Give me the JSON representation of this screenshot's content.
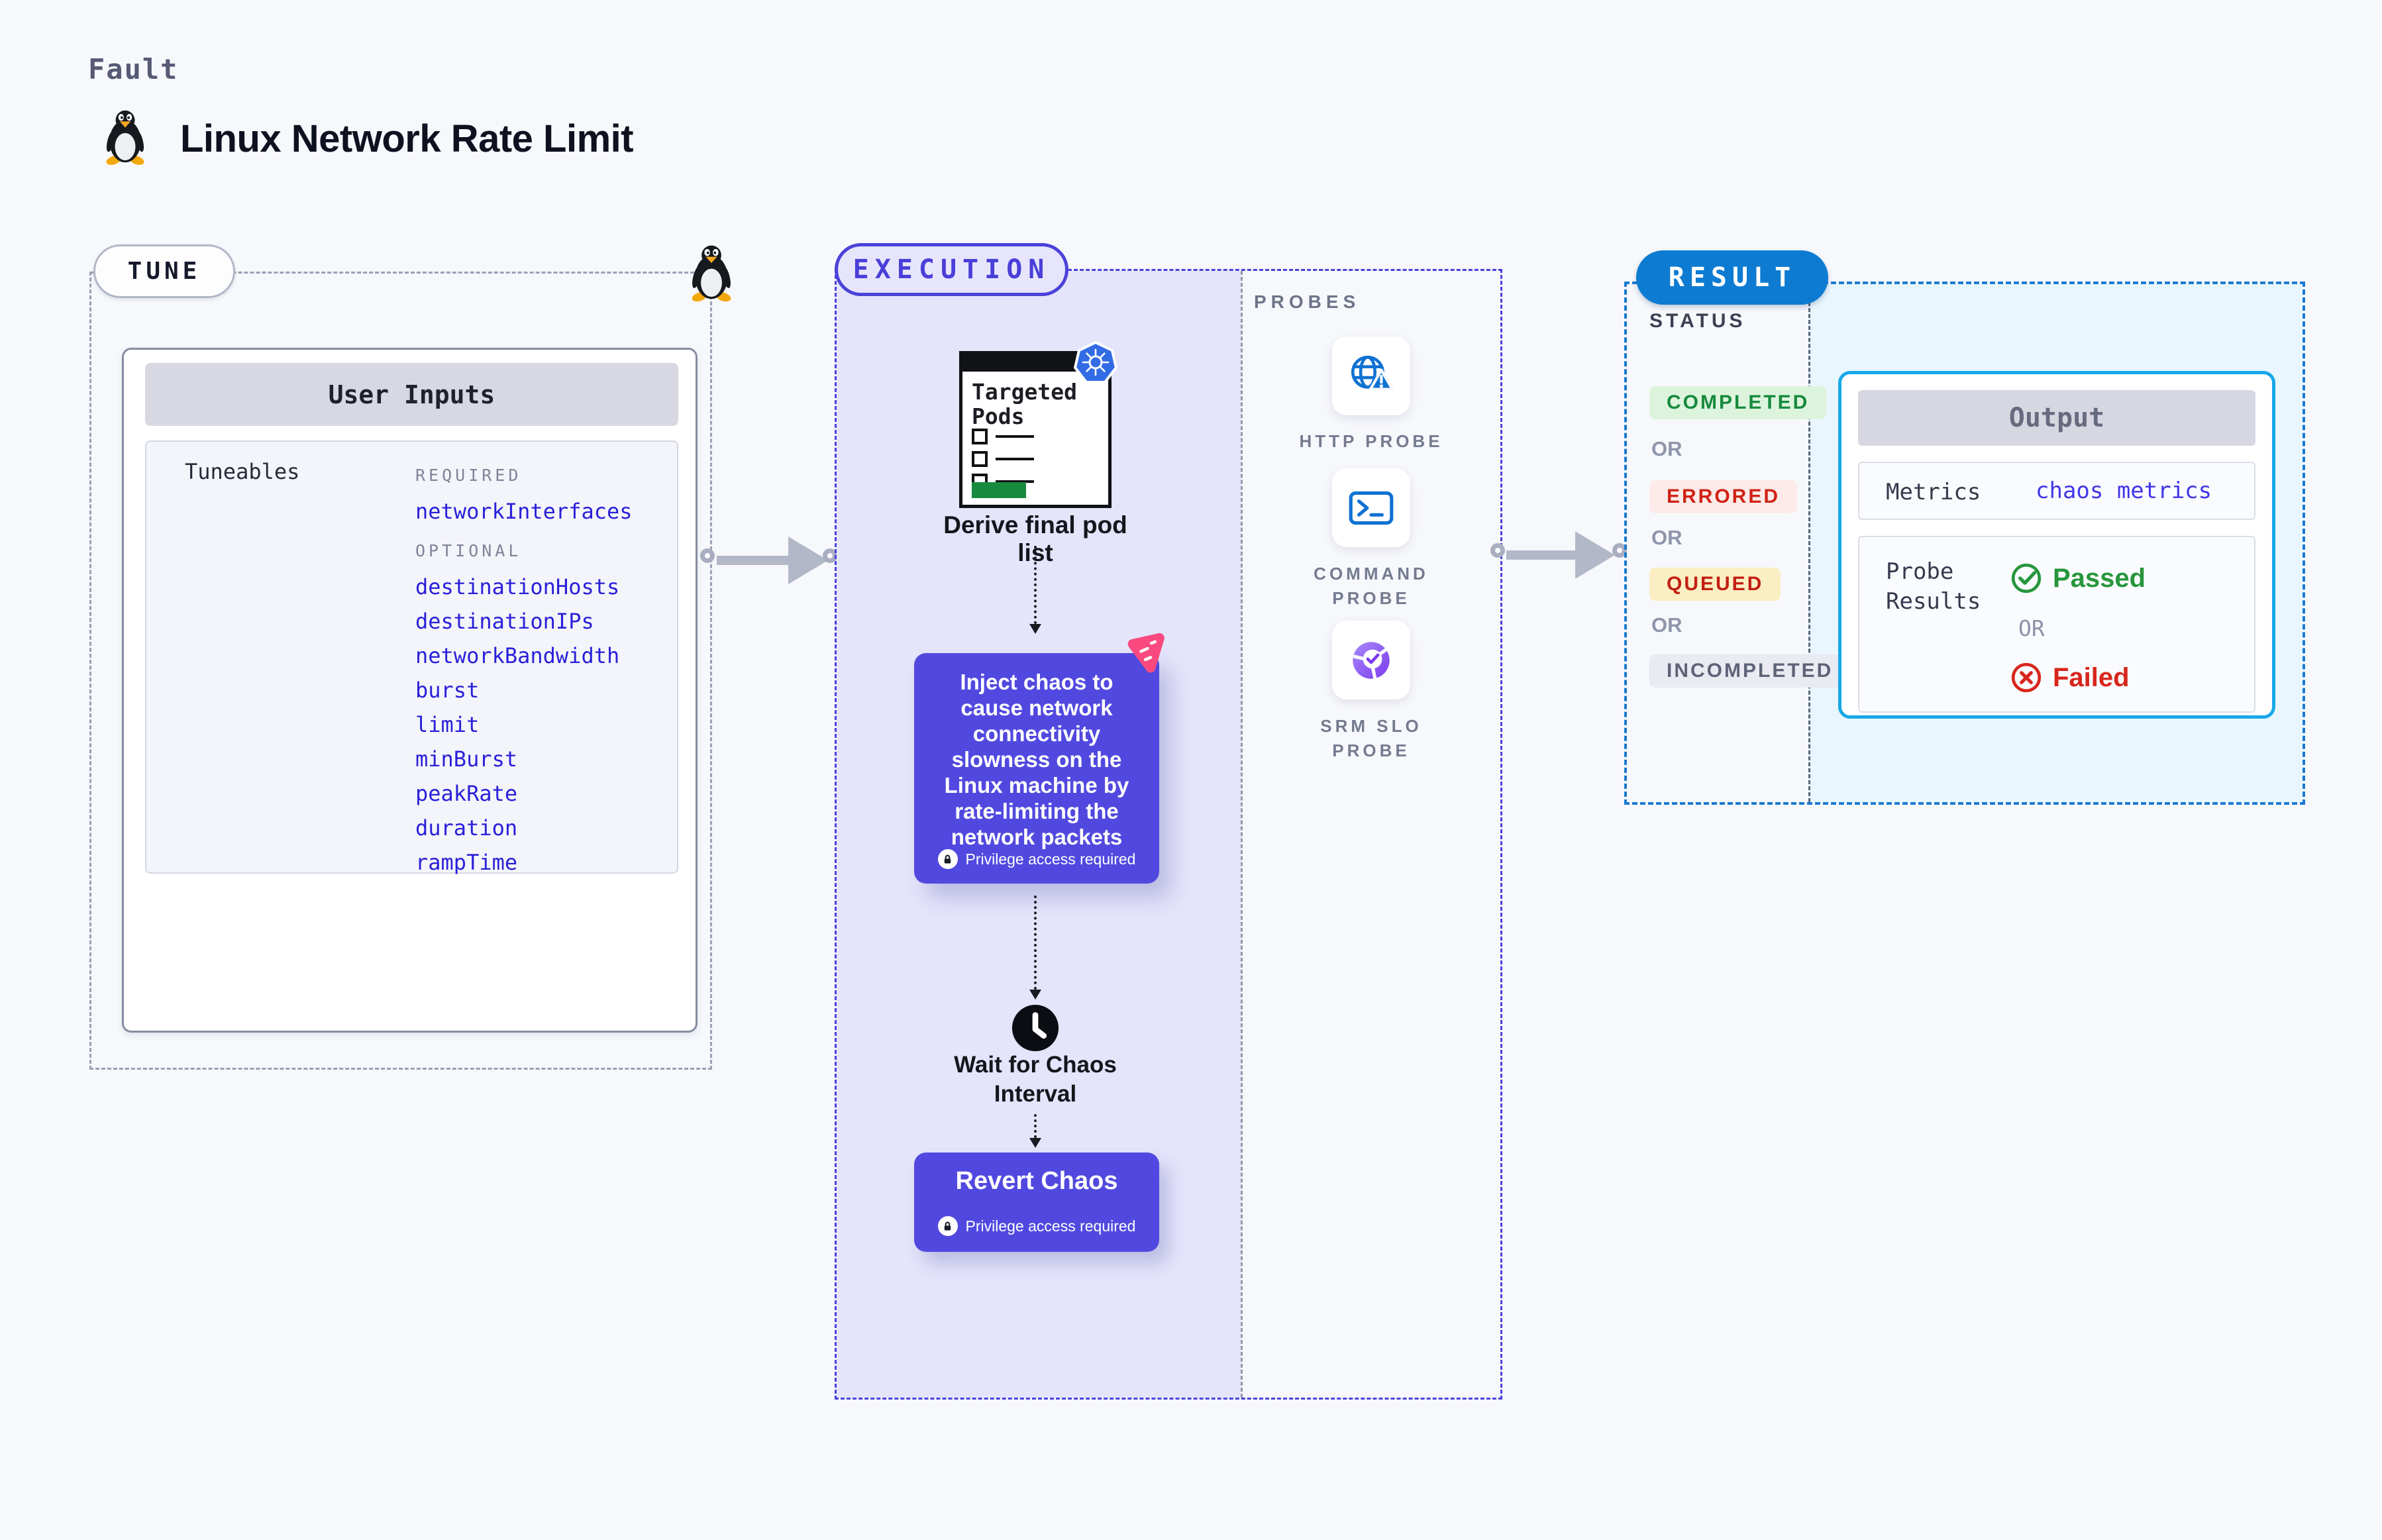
{
  "page": {
    "kicker": "Fault",
    "title": "Linux Network Rate Limit"
  },
  "tune": {
    "badge": "TUNE",
    "user_inputs_title": "User Inputs",
    "tuneables_label": "Tuneables",
    "required_label": "REQUIRED",
    "required_items": [
      "networkInterfaces"
    ],
    "optional_label": "OPTIONAL",
    "optional_items": [
      "destinationHosts",
      "destinationIPs",
      "networkBandwidth",
      "burst",
      "limit",
      "minBurst",
      "peakRate",
      "duration",
      "rampTime"
    ]
  },
  "execution": {
    "badge": "EXECUTION",
    "targeted_pods_label": "Targeted Pods",
    "derive_label": "Derive final pod list",
    "inject_text": "Inject chaos to cause network connectivity slowness on the Linux machine by rate-limiting the network packets",
    "privilege_label": "Privilege access required",
    "wait_label": "Wait for Chaos Interval",
    "revert_label": "Revert Chaos"
  },
  "probes": {
    "section_label": "PROBES",
    "items": [
      {
        "label": "HTTP PROBE",
        "icon": "http-probe-icon"
      },
      {
        "label": "COMMAND\nPROBE",
        "icon": "command-probe-icon"
      },
      {
        "label": "SRM SLO\nPROBE",
        "icon": "srm-slo-probe-icon"
      }
    ]
  },
  "result": {
    "badge": "RESULT",
    "status_label": "STATUS",
    "or_label": "OR",
    "statuses": [
      {
        "label": "COMPLETED",
        "color": "#168a3d",
        "bg": "#ddf4dc"
      },
      {
        "label": "ERRORED",
        "color": "#cf2318",
        "bg": "#fcebe8"
      },
      {
        "label": "QUEUED",
        "color": "#c21f14",
        "bg": "#fbeec2"
      },
      {
        "label": "INCOMPLETED",
        "color": "#5e6377",
        "bg": "#e9eaf2"
      }
    ],
    "output": {
      "title": "Output",
      "metrics_label": "Metrics",
      "metrics_value": "chaos metrics",
      "probe_results_label": "Probe Results",
      "passed_label": "Passed",
      "or_label": "OR",
      "failed_label": "Failed"
    }
  },
  "colors": {
    "accent_indigo": "#4a42d8",
    "accent_blue": "#0d7bd2",
    "accent_cyan": "#18a8e8",
    "chaos_purple": "#5149df",
    "chaos_pink": "#f9497f",
    "passed_green": "#27963c",
    "failed_red": "#d7261d",
    "kubernetes_blue": "#326ce5"
  }
}
